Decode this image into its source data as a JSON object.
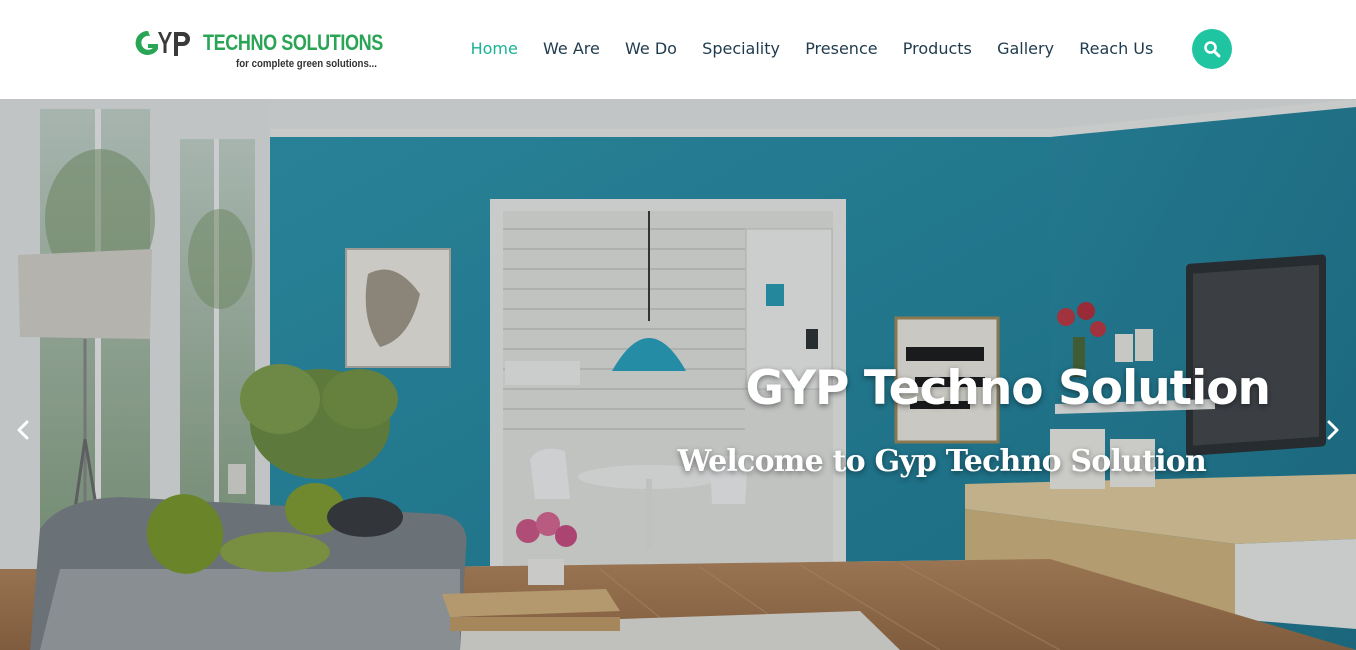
{
  "brand": {
    "name": "TECHNO SOLUTIONS",
    "tagline": "for complete green solutions...",
    "logo_letters": "GYP",
    "logo_icon": "gyp-logo-mark",
    "colors": {
      "green": "#2aa556",
      "dark": "#333333"
    }
  },
  "nav": {
    "items": [
      {
        "label": "Home",
        "active": true
      },
      {
        "label": "We Are"
      },
      {
        "label": "We Do"
      },
      {
        "label": "Speciality"
      },
      {
        "label": "Presence"
      },
      {
        "label": "Products"
      },
      {
        "label": "Gallery"
      },
      {
        "label": "Reach Us"
      }
    ],
    "active_color": "#1ab394",
    "text_color": "#1f3b4d"
  },
  "search": {
    "icon": "search-icon",
    "color": "#1fc4a0"
  },
  "hero": {
    "title": "GYP Techno Solution",
    "subtitle": "Welcome to Gyp Techno Solution",
    "prev_icon": "chevron-left-icon",
    "next_icon": "chevron-right-icon",
    "wall_color": "#2a8fa8"
  }
}
